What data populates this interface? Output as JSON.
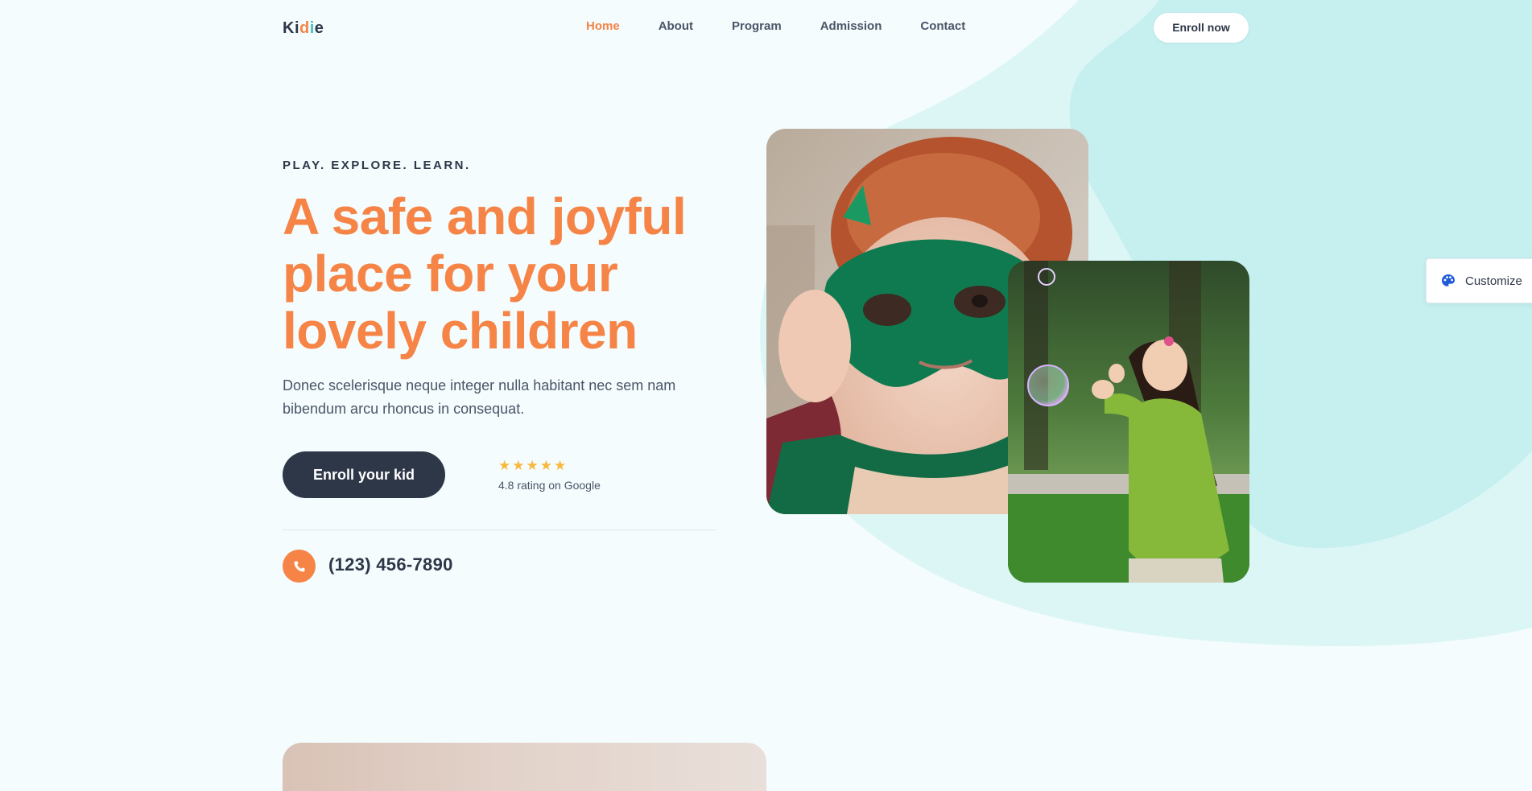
{
  "brand": {
    "logo_parts": [
      "K",
      "i",
      "d",
      "i",
      "e"
    ]
  },
  "nav": {
    "items": [
      {
        "label": "Home",
        "active": true
      },
      {
        "label": "About",
        "active": false
      },
      {
        "label": "Program",
        "active": false
      },
      {
        "label": "Admission",
        "active": false
      },
      {
        "label": "Contact",
        "active": false
      }
    ],
    "cta_label": "Enroll now"
  },
  "hero": {
    "eyebrow": "PLAY. EXPLORE. LEARN.",
    "headline": "A safe and joyful place for your lovely children",
    "lead": "Donec scelerisque neque integer nulla habitant nec sem nam bibendum arcu rhoncus in consequat.",
    "cta_label": "Enroll your kid",
    "rating": {
      "stars": 5,
      "text": "4.8 rating on Google"
    },
    "phone": "(123) 456-7890"
  },
  "customize": {
    "label": "Customize"
  },
  "colors": {
    "accent": "#f58446",
    "dark": "#2d3748",
    "teal_blob": "#c6eff0",
    "background": "#f4fcfd",
    "star": "#f6b93b"
  },
  "icons": {
    "phone": "phone-icon",
    "star": "star-icon",
    "palette": "palette-icon"
  }
}
